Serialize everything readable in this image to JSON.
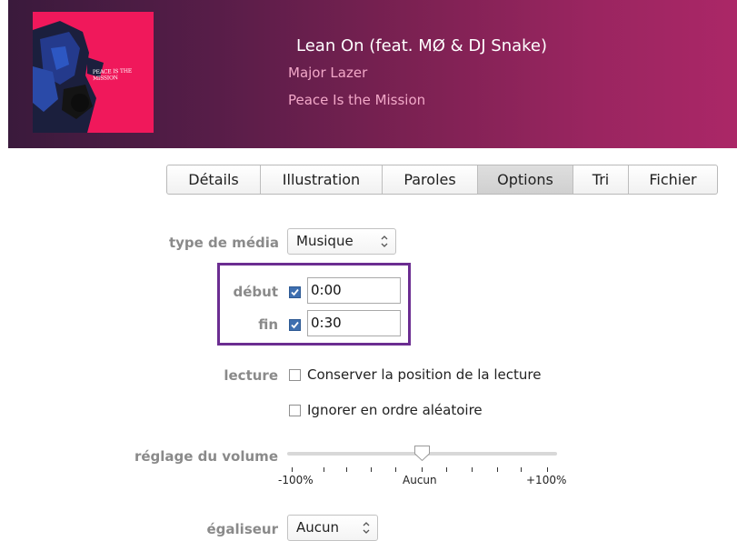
{
  "track": {
    "title": "Lean On (feat. MØ & DJ Snake)",
    "artist": "Major Lazer",
    "album": "Peace Is the Mission",
    "art_text_line1": "PEACE IS THE",
    "art_text_line2": "MISSION"
  },
  "tabs": [
    {
      "label": "Détails",
      "active": false
    },
    {
      "label": "Illustration",
      "active": false
    },
    {
      "label": "Paroles",
      "active": false
    },
    {
      "label": "Options",
      "active": true
    },
    {
      "label": "Tri",
      "active": false
    },
    {
      "label": "Fichier",
      "active": false
    }
  ],
  "options": {
    "media_type_label": "type de média",
    "media_type_value": "Musique",
    "start_label": "début",
    "start_checked": true,
    "start_value": "0:00",
    "end_label": "fin",
    "end_checked": true,
    "end_value": "0:30",
    "playback_label": "lecture",
    "remember_position_label": "Conserver la position de la lecture",
    "remember_position_checked": false,
    "skip_shuffle_label": "Ignorer en ordre aléatoire",
    "skip_shuffle_checked": false,
    "volume_label": "réglage du volume",
    "volume_adjust_percent": 0,
    "volume_min_label": "-100%",
    "volume_mid_label": "Aucun",
    "volume_max_label": "+100%",
    "equalizer_label": "égaliseur",
    "equalizer_value": "Aucun"
  },
  "colors": {
    "header_gradient_start": "#3a1a3c",
    "header_gradient_end": "#ab2767",
    "art_background": "#f0185b",
    "subtitle_pink": "#f2a8c8",
    "highlight_box": "#6b2d91",
    "checkbox_checked": "#3e6fb0"
  }
}
